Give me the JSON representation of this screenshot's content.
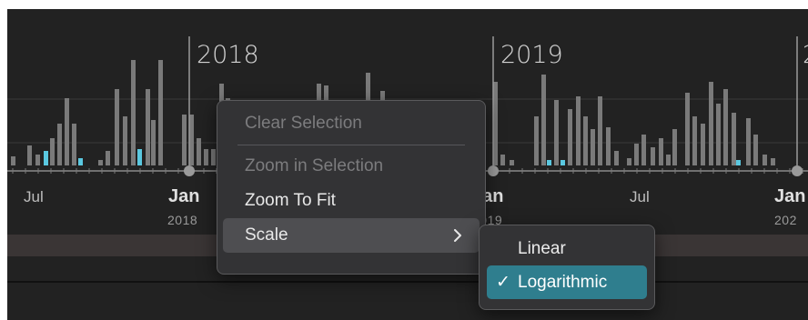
{
  "timeline": {
    "years": [
      "2018",
      "2019",
      "2"
    ],
    "month_label": "Jul",
    "jan_label": "Jan",
    "jan_years": [
      "2018",
      "2019",
      "202"
    ],
    "colors": {
      "background": "#222222",
      "bar": "#7a7a7a",
      "highlight_bar": "#5ac8e0",
      "axis": "#8a8a8a"
    }
  },
  "context_menu": {
    "items": [
      {
        "label": "Clear Selection",
        "enabled": false
      },
      {
        "label": "Zoom in Selection",
        "enabled": false
      },
      {
        "label": "Zoom To Fit",
        "enabled": true
      },
      {
        "label": "Scale",
        "enabled": true,
        "has_submenu": true
      }
    ],
    "chevron": "chevron-right-icon"
  },
  "scale_submenu": {
    "items": [
      {
        "label": "Linear",
        "selected": false
      },
      {
        "label": "Logarithmic",
        "selected": true
      }
    ],
    "checkmark": "✓",
    "selected_color": "#2f7e8e"
  }
}
